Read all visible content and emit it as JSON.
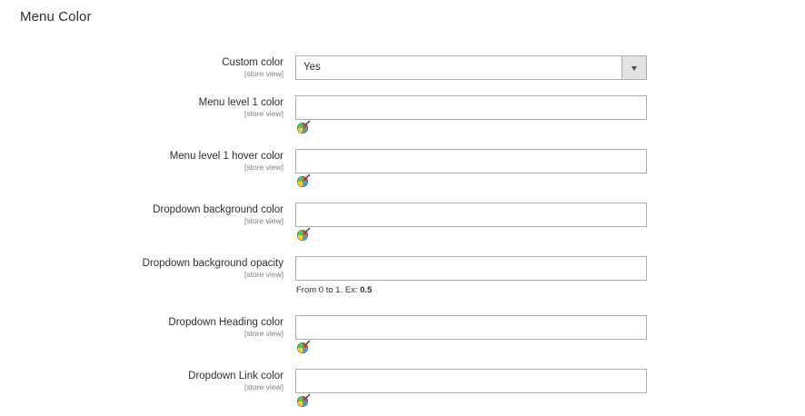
{
  "section": {
    "title": "Menu Color"
  },
  "fields": {
    "custom_color": {
      "label": "Custom color",
      "scope": "[store view]",
      "value": "Yes"
    },
    "menu_level1_color": {
      "label": "Menu level 1 color",
      "scope": "[store view]",
      "value": ""
    },
    "menu_level1_hover_color": {
      "label": "Menu level 1 hover color",
      "scope": "[store view]",
      "value": ""
    },
    "dropdown_background_color": {
      "label": "Dropdown background color",
      "scope": "[store view]",
      "value": ""
    },
    "dropdown_background_opacity": {
      "label": "Dropdown background opacity",
      "scope": "[store view]",
      "value": "",
      "note_prefix": "From 0 to 1. Ex:",
      "note_example": "0.5"
    },
    "dropdown_heading_color": {
      "label": "Dropdown Heading color",
      "scope": "[store view]",
      "value": ""
    },
    "dropdown_link_color": {
      "label": "Dropdown Link color",
      "scope": "[store view]",
      "value": ""
    }
  },
  "icons": {
    "color_picker": "color-picker-icon",
    "select_arrow": "chevron-down-icon"
  },
  "colors": {
    "border": "#adadad",
    "select_button_bg": "#e3e3e3",
    "text": "#303030",
    "scope_text": "#808080"
  }
}
